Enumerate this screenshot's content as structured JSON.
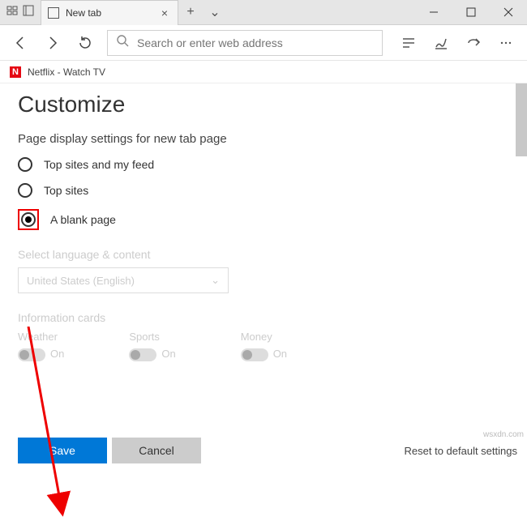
{
  "titlebar": {
    "tab_title": "New tab"
  },
  "toolbar": {
    "search_placeholder": "Search or enter web address"
  },
  "bookmark": {
    "label": "Netflix - Watch TV"
  },
  "page": {
    "heading": "Customize",
    "subheading": "Page display settings for new tab page",
    "options": {
      "topfeed": "Top sites and my feed",
      "topsites": "Top sites",
      "blank": "A blank page"
    },
    "lang_heading": "Select language & content",
    "lang_value": "United States (English)",
    "cards_heading": "Information cards",
    "cards": {
      "weather": "Weather",
      "sports": "Sports",
      "money": "Money",
      "state": "On"
    },
    "save": "Save",
    "cancel": "Cancel",
    "reset": "Reset to default settings"
  },
  "watermark": "wsxdn.com"
}
